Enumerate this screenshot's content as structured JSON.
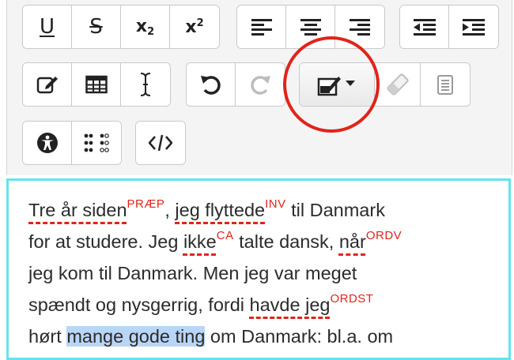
{
  "toolbar": {
    "underline_glyph": "U",
    "strike_glyph": "S",
    "subscript_base": "x",
    "subscript_index": "2",
    "superscript_base": "x",
    "superscript_index": "2"
  },
  "editor": {
    "lines": [
      [
        {
          "text": "Tre år siden",
          "error": true
        },
        {
          "tag": "PRÆP"
        },
        {
          "text": ", "
        },
        {
          "text": "jeg flyttede",
          "error": true
        },
        {
          "tag": "INV"
        },
        {
          "text": " til Danmark"
        }
      ],
      [
        {
          "text": "for at studere. Jeg "
        },
        {
          "text": "ikke",
          "error": true
        },
        {
          "tag": "CA"
        },
        {
          "text": " talte dansk, "
        },
        {
          "text": "når",
          "error": true
        },
        {
          "tag": "ORDV"
        }
      ],
      [
        {
          "text": "jeg kom til Danmark. Men jeg var meget"
        }
      ],
      [
        {
          "text": "spændt og nysgerrig, fordi "
        },
        {
          "text": "havde jeg",
          "error": true
        },
        {
          "tag": "ORDST"
        }
      ],
      [
        {
          "text": "hørt "
        },
        {
          "text": "mange gode ting",
          "highlight": true
        },
        {
          "text": " om Danmark: bl.a. om"
        }
      ]
    ]
  },
  "colors": {
    "error": "#e0241b",
    "editor_border": "#66e3ef",
    "selection": "#b9d6f7",
    "annotation_circle": "#e0241b"
  },
  "icons": {
    "row1": [
      "underline-icon",
      "strikethrough-icon",
      "subscript-icon",
      "superscript-icon",
      "align-left-icon",
      "align-center-icon",
      "align-right-icon",
      "outdent-icon",
      "indent-icon"
    ],
    "row2": [
      "edit-pencil-icon",
      "table-icon",
      "text-cursor-icon",
      "undo-icon",
      "redo-icon",
      "annotate-dropdown-icon",
      "eraser-icon",
      "paste-text-icon"
    ],
    "row3": [
      "accessibility-icon",
      "braille-icon",
      "html-code-icon"
    ]
  }
}
